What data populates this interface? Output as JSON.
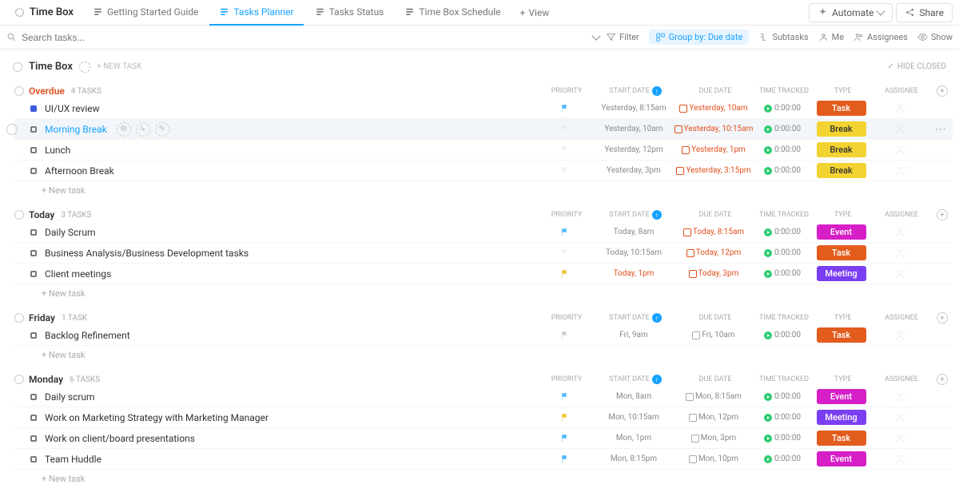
{
  "topbar": {
    "workspace": "Time Box",
    "views": [
      {
        "label": "Getting Started Guide",
        "active": false
      },
      {
        "label": "Tasks Planner",
        "active": true
      },
      {
        "label": "Tasks Status",
        "active": false
      },
      {
        "label": "Time Box Schedule",
        "active": false
      }
    ],
    "add_view": "View",
    "automate": "Automate",
    "share": "Share"
  },
  "filterbar": {
    "search_placeholder": "Search tasks...",
    "filter": "Filter",
    "group_by": "Group by: Due date",
    "subtasks": "Subtasks",
    "me": "Me",
    "assignees": "Assignees",
    "show": "Show"
  },
  "list": {
    "title": "Time Box",
    "new_task": "+ NEW TASK",
    "hide_closed": "HIDE CLOSED"
  },
  "columns": {
    "priority": "PRIORITY",
    "start": "START DATE",
    "due": "DUE DATE",
    "time": "TIME TRACKED",
    "type": "TYPE",
    "assignee": "ASSIGNEE"
  },
  "type_colors": {
    "Task": "#e25c1e",
    "Break": "#f3d331",
    "Event": "#d61fc6",
    "Meeting": "#7a3ff2"
  },
  "new_task_label": "+ New task",
  "groups": [
    {
      "name": "Overdue",
      "overdue_style": true,
      "count": "4 TASKS",
      "tasks": [
        {
          "name": "UI/UX review",
          "status": "blue",
          "priority": "blue",
          "start": "Yesterday, 8:15am",
          "due": "Yesterday, 10am",
          "due_over": true,
          "time": "0:00:00",
          "type": "Task"
        },
        {
          "name": "Morning Break",
          "status": "open",
          "active": true,
          "hovered": true,
          "priority": "none",
          "start": "Yesterday, 10am",
          "due": "Yesterday, 10:15am",
          "due_over": true,
          "time": "0:00:00",
          "type": "Break"
        },
        {
          "name": "Lunch",
          "status": "open",
          "priority": "none",
          "start": "Yesterday, 12pm",
          "due": "Yesterday, 1pm",
          "due_over": true,
          "time": "0:00:00",
          "type": "Break"
        },
        {
          "name": "Afternoon Break",
          "status": "open",
          "priority": "none",
          "start": "Yesterday, 3pm",
          "due": "Yesterday, 3:15pm",
          "due_over": true,
          "time": "0:00:00",
          "type": "Break"
        }
      ]
    },
    {
      "name": "Today",
      "count": "3 TASKS",
      "tasks": [
        {
          "name": "Daily Scrum",
          "status": "open",
          "priority": "blue",
          "start": "Today, 8am",
          "due": "Today, 8:15am",
          "due_over": true,
          "time": "0:00:00",
          "type": "Event"
        },
        {
          "name": "Business Analysis/Business Development tasks",
          "status": "open",
          "priority": "none",
          "start": "Today, 10:15am",
          "due": "Today, 12pm",
          "due_over": true,
          "time": "0:00:00",
          "type": "Task"
        },
        {
          "name": "Client meetings",
          "status": "open",
          "priority": "yellow",
          "start": "Today, 1pm",
          "start_over": true,
          "due": "Today, 3pm",
          "due_over": true,
          "time": "0:00:00",
          "type": "Meeting"
        }
      ]
    },
    {
      "name": "Friday",
      "count": "1 TASK",
      "tasks": [
        {
          "name": "Backlog Refinement",
          "status": "open",
          "priority": "gray",
          "start": "Fri, 9am",
          "due": "Fri, 10am",
          "time": "0:00:00",
          "type": "Task"
        }
      ]
    },
    {
      "name": "Monday",
      "count": "6 TASKS",
      "tasks": [
        {
          "name": "Daily scrum",
          "status": "open",
          "priority": "blue",
          "start": "Mon, 8am",
          "due": "Mon, 8:15am",
          "time": "0:00:00",
          "type": "Event"
        },
        {
          "name": "Work on Marketing Strategy with Marketing Manager",
          "status": "open",
          "priority": "yellow",
          "start": "Mon, 10:15am",
          "due": "Mon, 12pm",
          "time": "0:00:00",
          "type": "Meeting"
        },
        {
          "name": "Work on client/board presentations",
          "status": "open",
          "priority": "blue",
          "start": "Mon, 1pm",
          "due": "Mon, 3pm",
          "time": "0:00:00",
          "type": "Task"
        },
        {
          "name": "Team Huddle",
          "status": "open",
          "priority": "blue",
          "start": "Mon, 8:15pm",
          "due": "Mon, 10pm",
          "time": "0:00:00",
          "type": "Event"
        }
      ]
    }
  ]
}
